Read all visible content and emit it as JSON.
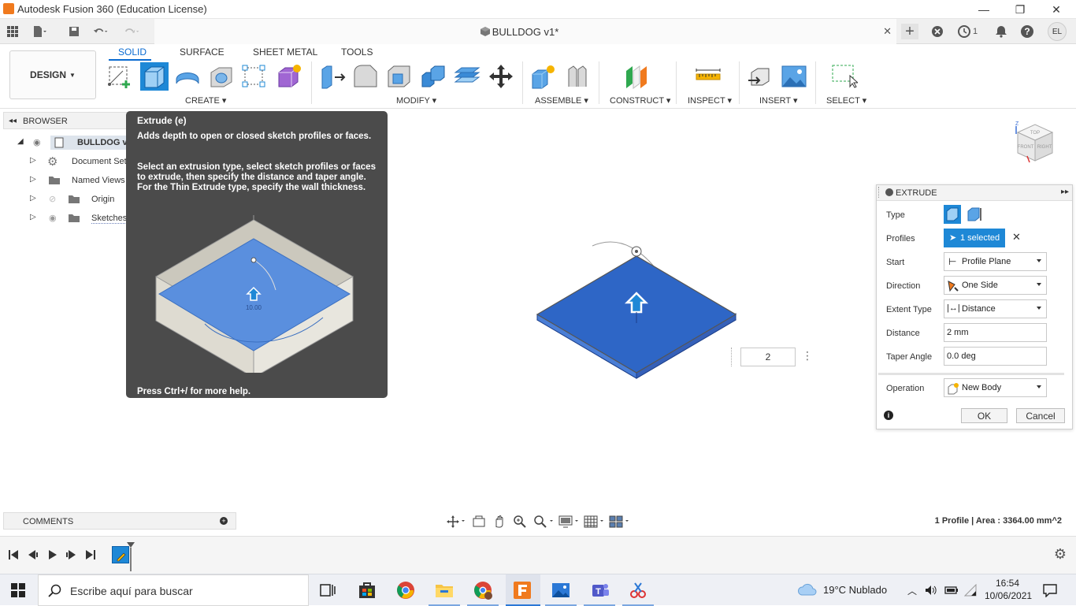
{
  "window": {
    "title": "Autodesk Fusion 360 (Education License)",
    "minimize": "—",
    "restore": "❐",
    "close": "✕"
  },
  "tabs": {
    "document_title": "BULLDOG v1*",
    "close_glyph": "✕",
    "job_count": "1",
    "user_initials": "EL"
  },
  "ribbon": {
    "workspace": "DESIGN",
    "tabs": [
      "SOLID",
      "SURFACE",
      "SHEET METAL",
      "TOOLS"
    ],
    "groups": [
      "CREATE",
      "MODIFY",
      "ASSEMBLE",
      "CONSTRUCT",
      "INSPECT",
      "INSERT",
      "SELECT"
    ]
  },
  "browser": {
    "header": "BROWSER",
    "root": "BULLDOG v",
    "items": [
      "Document Sett",
      "Named Views",
      "Origin",
      "Sketches"
    ]
  },
  "tooltip": {
    "title": "Extrude (e)",
    "description": "Adds depth to open or closed sketch profiles or faces.",
    "instructions": "Select an extrusion type, select sketch profiles or faces to extrude, then specify the distance and taper angle. For the Thin Extrude type, specify the wall thickness.",
    "image_label": "10.00",
    "footer": "Press Ctrl+/ for more help."
  },
  "extrude": {
    "header": "EXTRUDE",
    "type_label": "Type",
    "profiles_label": "Profiles",
    "profiles_value": "1 selected",
    "start_label": "Start",
    "start_value": "Profile Plane",
    "direction_label": "Direction",
    "direction_value": "One Side",
    "extent_label": "Extent Type",
    "extent_value": "Distance",
    "distance_label": "Distance",
    "distance_value": "2 mm",
    "taper_label": "Taper Angle",
    "taper_value": "0.0 deg",
    "operation_label": "Operation",
    "operation_value": "New Body",
    "ok": "OK",
    "cancel": "Cancel"
  },
  "viewport": {
    "distance_input": "2",
    "viewcube_top": "TOP",
    "viewcube_front": "FRONT",
    "viewcube_right": "RIGHT"
  },
  "comments": {
    "label": "COMMENTS"
  },
  "status": {
    "text": "1 Profile | Area : 3364.00 mm^2"
  },
  "taskbar": {
    "search_placeholder": "Escribe aquí para buscar",
    "weather": "19°C  Nublado",
    "time": "16:54",
    "date": "10/06/2021"
  },
  "colors": {
    "accent": "#0a6bd1",
    "selection_blue": "#1e88d6",
    "extrude_blue": "#2d62c0",
    "tooltip_bg": "#4b4b4b"
  }
}
